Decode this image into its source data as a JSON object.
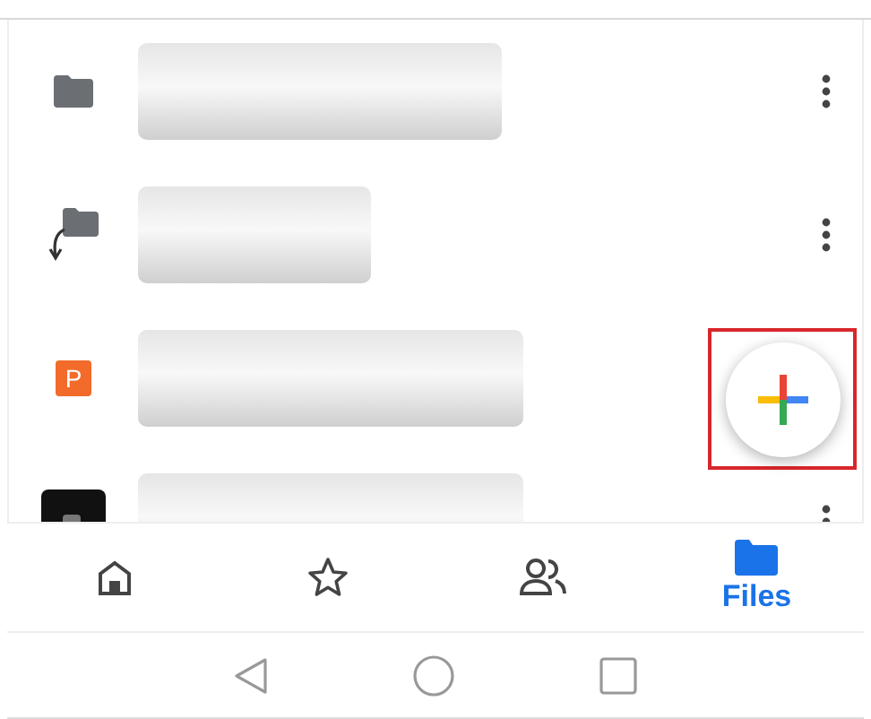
{
  "files": [
    {
      "kind": "folder",
      "menu": true
    },
    {
      "kind": "shared-folder",
      "menu": true
    },
    {
      "kind": "slides",
      "badge": "P",
      "menu": false
    },
    {
      "kind": "image",
      "menu": true
    }
  ],
  "fab": {
    "highlighted": true
  },
  "bottom_nav": [
    {
      "kind": "home",
      "selected": false
    },
    {
      "kind": "starred",
      "selected": false
    },
    {
      "kind": "shared",
      "selected": false
    },
    {
      "kind": "files",
      "selected": true,
      "label": "Files"
    }
  ],
  "system_nav": [
    {
      "kind": "back"
    },
    {
      "kind": "home"
    },
    {
      "kind": "recents"
    }
  ]
}
